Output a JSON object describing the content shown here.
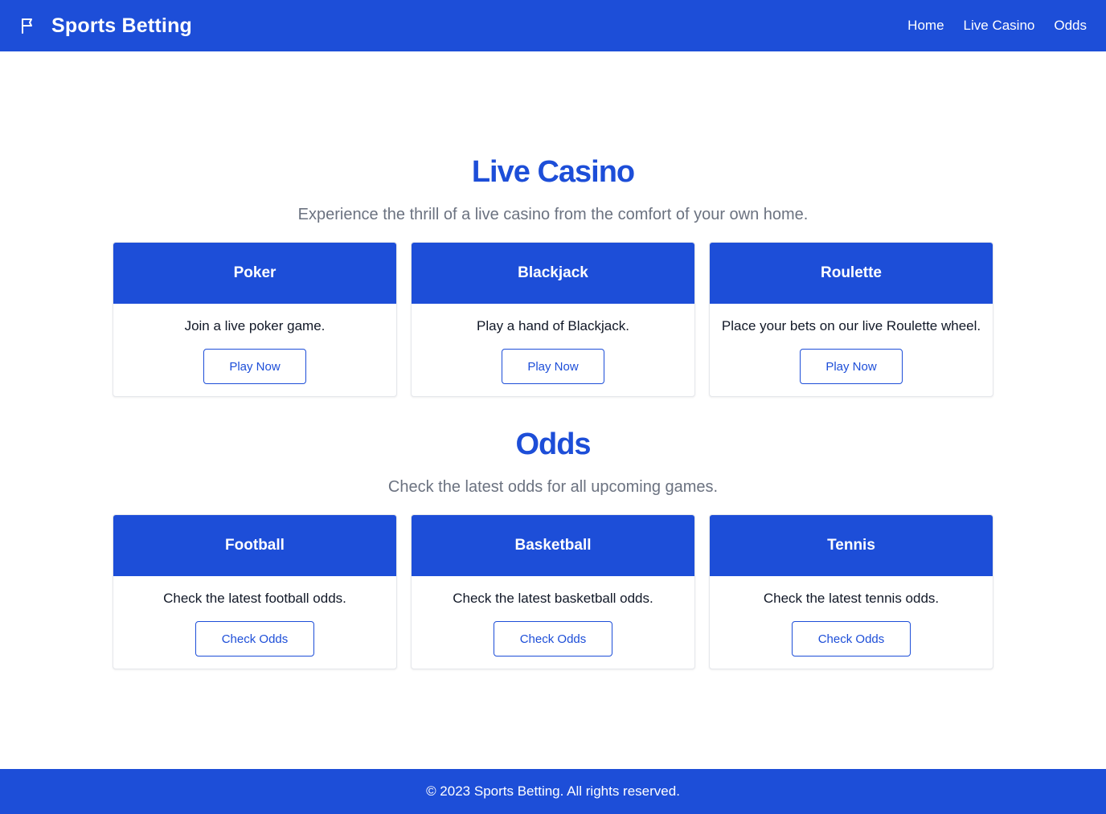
{
  "colors": {
    "primary": "#1d4ed8",
    "subtitle": "#6b7280",
    "text": "#111827"
  },
  "header": {
    "title": "Sports Betting",
    "icon": "flag-icon",
    "nav": [
      "Home",
      "Live Casino",
      "Odds"
    ]
  },
  "live_casino": {
    "heading": "Live Casino",
    "subtitle": "Experience the thrill of a live casino from the comfort of your own home.",
    "cards": [
      {
        "title": "Poker",
        "description": "Join a live poker game.",
        "button": "Play Now"
      },
      {
        "title": "Blackjack",
        "description": "Play a hand of Blackjack.",
        "button": "Play Now"
      },
      {
        "title": "Roulette",
        "description": "Place your bets on our live Roulette wheel.",
        "button": "Play Now"
      }
    ]
  },
  "odds": {
    "heading": "Odds",
    "subtitle": "Check the latest odds for all upcoming games.",
    "cards": [
      {
        "title": "Football",
        "description": "Check the latest football odds.",
        "button": "Check Odds"
      },
      {
        "title": "Basketball",
        "description": "Check the latest basketball odds.",
        "button": "Check Odds"
      },
      {
        "title": "Tennis",
        "description": "Check the latest tennis odds.",
        "button": "Check Odds"
      }
    ]
  },
  "footer": {
    "text": "© 2023 Sports Betting. All rights reserved."
  }
}
